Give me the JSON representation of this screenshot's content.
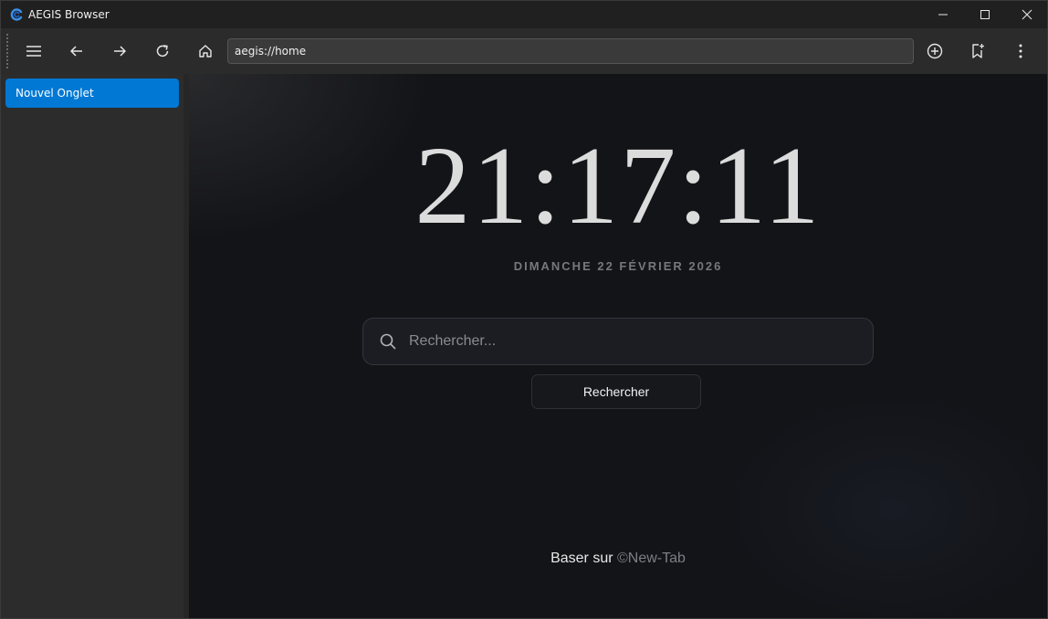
{
  "window": {
    "title": "AEGIS Browser",
    "controls": [
      "minimize-icon",
      "maximize-icon",
      "close-icon"
    ]
  },
  "toolbar": {
    "buttons": [
      "menu-icon",
      "back-arrow-icon",
      "forward-arrow-icon",
      "reload-icon",
      "home-icon"
    ],
    "address": "aegis://home",
    "right_buttons": [
      "new-tab-plus-icon",
      "bookmark-add-icon",
      "more-vertical-icon"
    ]
  },
  "sidebar": {
    "tabs": [
      {
        "label": "Nouvel Onglet",
        "active": true
      }
    ]
  },
  "main": {
    "clock": "21:17:11",
    "date": "DIMANCHE 22 FÉVRIER 2026",
    "search": {
      "placeholder": "Rechercher...",
      "value": ""
    },
    "search_button": "Rechercher",
    "footer": {
      "prefix": "Baser sur ",
      "link": "©New-Tab"
    }
  },
  "colors": {
    "accent": "#0078d4",
    "background": "#131418",
    "titlebar": "#202020",
    "toolbar": "#2b2b2b",
    "sidebar": "#2c2c2c"
  }
}
